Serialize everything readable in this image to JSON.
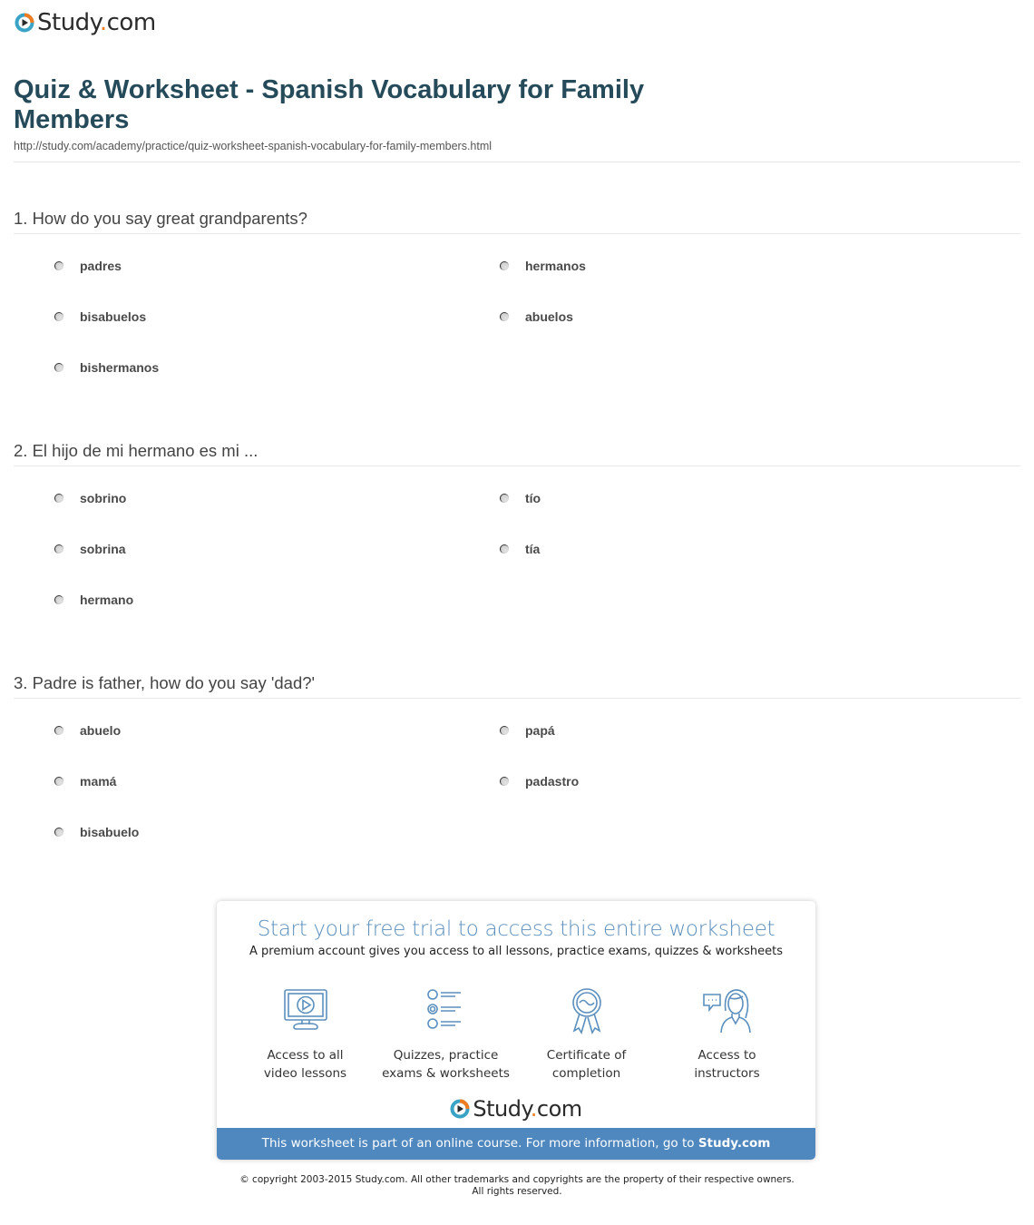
{
  "header": {
    "logo_name": "Study",
    "logo_dot": ".",
    "logo_tld": "com",
    "brand_colors": {
      "teal": "#3aa3c6",
      "orange": "#f07c21",
      "dark": "#2b2b2b"
    }
  },
  "page": {
    "title": "Quiz & Worksheet - Spanish Vocabulary for Family Members",
    "url": "http://study.com/academy/practice/quiz-worksheet-spanish-vocabulary-for-family-members.html"
  },
  "questions": [
    {
      "text": "1. How do you say great grandparents?",
      "answers": [
        "padres",
        "hermanos",
        "bisabuelos",
        "abuelos",
        "bishermanos"
      ]
    },
    {
      "text": "2. El hijo de mi hermano es mi ...",
      "answers": [
        "sobrino",
        "tío",
        "sobrina",
        "tía",
        "hermano"
      ]
    },
    {
      "text": "3. Padre is father, how do you say 'dad?'",
      "answers": [
        "abuelo",
        "papá",
        "mamá",
        "padastro",
        "bisabuelo"
      ]
    }
  ],
  "promo": {
    "title": "Start your free trial to access this entire worksheet",
    "subtitle": "A premium account gives you access to all lessons, practice exams, quizzes & worksheets",
    "features": [
      {
        "icon": "video-monitor-icon",
        "line1": "Access to all",
        "line2": "video lessons"
      },
      {
        "icon": "quiz-list-icon",
        "line1": "Quizzes, practice",
        "line2": "exams & worksheets"
      },
      {
        "icon": "certificate-ribbon-icon",
        "line1": "Certificate of",
        "line2": "completion"
      },
      {
        "icon": "instructor-chat-icon",
        "line1": "Access to",
        "line2": "instructors"
      }
    ],
    "bar_text": "This worksheet is part of an online course. For more information, go to ",
    "bar_link": "Study.com",
    "accent_color": "#4f87bf"
  },
  "footer": {
    "copyright_line1": "© copyright 2003-2015 Study.com. All other trademarks and copyrights are the property of their respective owners.",
    "copyright_line2": "All rights reserved."
  }
}
